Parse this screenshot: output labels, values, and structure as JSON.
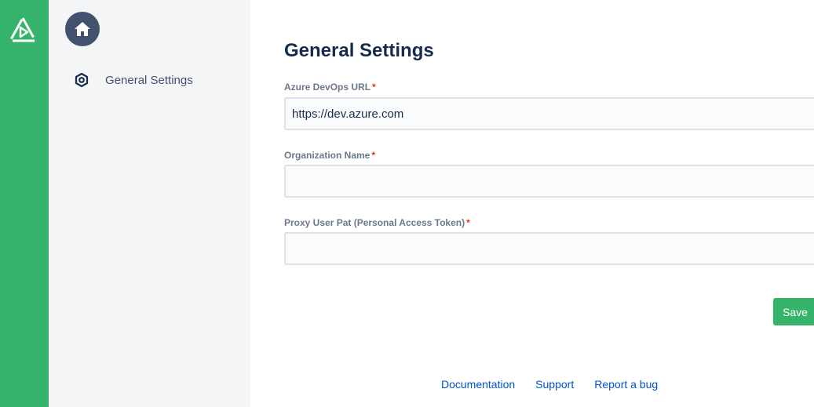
{
  "icons": {
    "logo": "triangle-play-logo-icon",
    "home": "home-icon",
    "settings": "hexagon-gear-icon"
  },
  "colors": {
    "rail": "#36b36b",
    "panel": "#f4f5f7",
    "accent": "#36b36b",
    "link": "#0052cc",
    "required": "#de350b"
  },
  "nav": {
    "items": [
      {
        "label": "General Settings"
      }
    ]
  },
  "page": {
    "title": "General Settings"
  },
  "form": {
    "fields": [
      {
        "label": "Azure DevOps URL",
        "required_mark": "*",
        "value": "https://dev.azure.com",
        "placeholder": ""
      },
      {
        "label": "Organization Name",
        "required_mark": "*",
        "value": "",
        "placeholder": ""
      },
      {
        "label": "Proxy User Pat (Personal Access Token)",
        "required_mark": "*",
        "value": "",
        "placeholder": ""
      }
    ],
    "save_label": "Save"
  },
  "footer": {
    "links": [
      "Documentation",
      "Support",
      "Report a bug"
    ]
  }
}
